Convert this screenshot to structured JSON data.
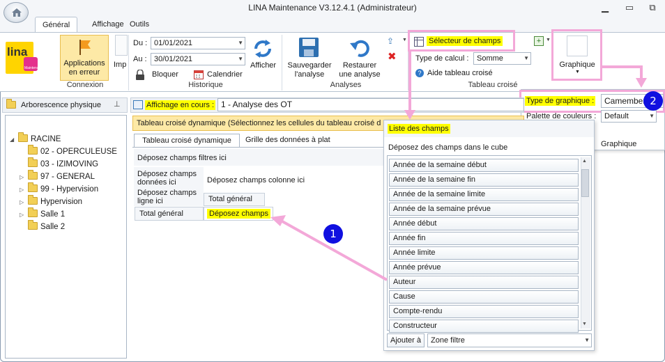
{
  "window": {
    "title": "LINA Maintenance  V3.12.4.1  (Administrateur)"
  },
  "tabs": [
    {
      "label": "Général"
    },
    {
      "label": "Affichage"
    },
    {
      "label": "Outils"
    }
  ],
  "ribbon": {
    "connexion": {
      "logo_text": "lina",
      "logo_sub": "Maintenance",
      "apps_error_label": "Applications en erreur",
      "imp_label": "Imp",
      "group_label": "Connexion"
    },
    "historique": {
      "du_label": "Du :",
      "du_value": "01/01/2021",
      "au_label": "Au :",
      "au_value": "30/01/2021",
      "bloquer_label": "Bloquer",
      "calendrier_label": "Calendrier",
      "afficher_label": "Afficher",
      "group_label": "Historique"
    },
    "analyses": {
      "save_label": "Sauvegarder l'analyse",
      "restore_label": "Restaurer une analyse",
      "group_label": "Analyses"
    },
    "tableau_croise": {
      "field_selector_label": "Sélecteur de champs",
      "calc_type_label": "Type de calcul :",
      "calc_type_value": "Somme",
      "help_label": "Aide tableau croisé",
      "group_label": "Tableau croisé"
    },
    "graphique": {
      "button_label": "Graphique"
    }
  },
  "graph_popup": {
    "type_label": "Type de graphique :",
    "type_value": "Camembert",
    "palette_label": "Palette de couleurs :",
    "palette_value": "Default",
    "group_label": "Graphique"
  },
  "left_panel": {
    "header": "Arborescence physique",
    "tree": [
      {
        "label": "RACINE",
        "level": 0,
        "expander": "◢"
      },
      {
        "label": "02 - OPERCULEUSE",
        "level": 1,
        "expander": ""
      },
      {
        "label": "03 - IZIMOVING",
        "level": 1,
        "expander": ""
      },
      {
        "label": "97 - GENERAL",
        "level": 1,
        "expander": "▷"
      },
      {
        "label": "99 - Hypervision",
        "level": 1,
        "expander": "▷"
      },
      {
        "label": "Hypervision",
        "level": 1,
        "expander": "▷"
      },
      {
        "label": "Salle 1",
        "level": 1,
        "expander": "▷"
      },
      {
        "label": "Salle 2",
        "level": 1,
        "expander": ""
      }
    ]
  },
  "main": {
    "affichage_label": "Affichage en cours :",
    "affichage_value": "1 - Analyse des OT",
    "pivot_header": "Tableau croisé dynamique (Sélectionnez les cellules du tableau croisé d",
    "subtabs": [
      {
        "label": "Tableau croisé dynamique"
      },
      {
        "label": "Grille des données à plat"
      }
    ],
    "drop_filters": "Déposez champs filtres ici",
    "drop_data": "Déposez champs données ici",
    "drop_columns": "Déposez champs colonne ici",
    "drop_rows": "Déposez champs ligne ici",
    "total_general_col": "Total général",
    "total_general_row": "Total général",
    "drop_cell": "Déposez champs"
  },
  "fields_panel": {
    "title": "Liste des champs",
    "subtitle": "Déposez des champs dans le cube",
    "fields": [
      "Année de la semaine début",
      "Année de la semaine fin",
      "Année de la semaine limite",
      "Année de la semaine prévue",
      "Année début",
      "Année fin",
      "Année limite",
      "Année prévue",
      "Auteur",
      "Cause",
      "Compte-rendu",
      "Constructeur"
    ],
    "add_label": "Ajouter à",
    "zone_value": "Zone filtre"
  },
  "annotations": {
    "badge1": "1",
    "badge2": "2"
  },
  "colors": {
    "highlight": "#ffff00",
    "annotation_pink": "#f3a8d8",
    "badge_blue": "#1010e0"
  }
}
